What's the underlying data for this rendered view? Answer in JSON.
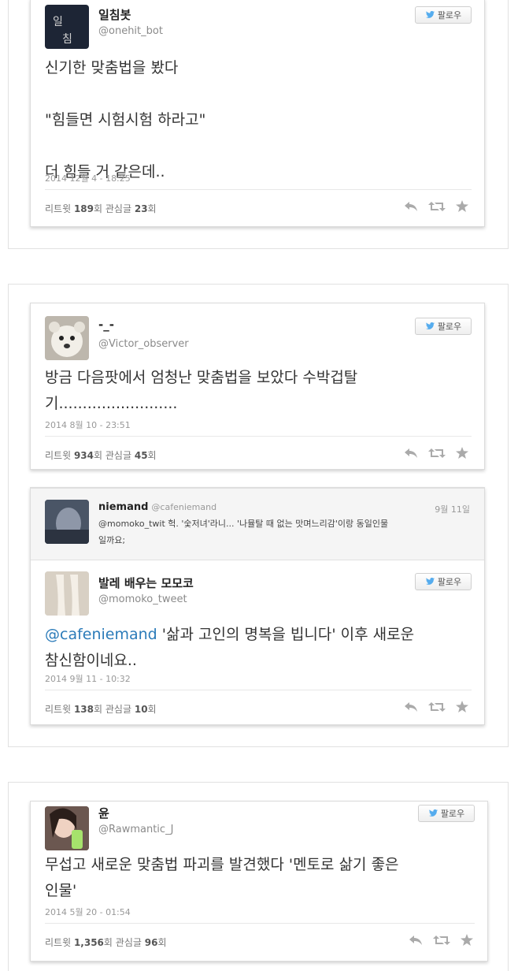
{
  "follow_label": "팔로우",
  "tweets": [
    {
      "name": "일침봇",
      "handle": "@onehit_bot",
      "text": "신기한 맞춤법을 봤다\n\n\"힘들면 시험시험 하라고\"\n\n더 힘들 거 같은데..",
      "date": "2014 12월 4 - 18:25",
      "retweets": "189",
      "favorites": "23",
      "retweet_label": "리트윗",
      "fav_label": "관심글",
      "count_suffix": "회"
    },
    {
      "name": "-_-",
      "handle": "@Victor_observer",
      "text": "방금 다음팟에서 엄청난 맞춤법을 보았다 수박겁탈\n기.........................",
      "date": "2014 8월 10 - 23:51",
      "retweets": "934",
      "favorites": "45",
      "retweet_label": "리트윗",
      "fav_label": "관심글",
      "count_suffix": "회"
    },
    {
      "name": "발레 배우는 모모코",
      "handle": "@momoko_tweet",
      "mention": "@cafeniemand",
      "text": " '삶과 고인의 명복을 빕니다' 이후 새로운\n참신함이네요..",
      "date": "2014 9월 11 - 10:32",
      "retweets": "138",
      "favorites": "10",
      "retweet_label": "리트윗",
      "fav_label": "관심글",
      "count_suffix": "회"
    },
    {
      "name": "윤",
      "handle": "@Rawmantic_J",
      "text": "무섭고 새로운 맞춤법 파괴를 발견했다 '멘토로 삶기 좋은\n인물'",
      "date": "2014 5월 20 - 01:54",
      "retweets": "1,356",
      "favorites": "96",
      "retweet_label": "리트윗",
      "fav_label": "관심글",
      "count_suffix": "회"
    }
  ],
  "reply": {
    "name": "niemand",
    "handle": "@cafeniemand",
    "date": "9월 11일",
    "text": "@momoko_twit 헉. '숯저녀'라니... '나뮬탈 때 없는 맛며느리감'이랑 동일인물\n일까요;"
  },
  "colors": {
    "link": "#2b7bb9",
    "muted": "#999999",
    "text": "#333333"
  }
}
